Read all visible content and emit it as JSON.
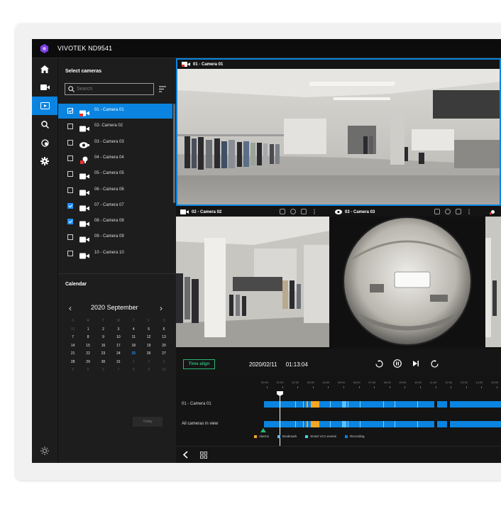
{
  "app": {
    "title": "VIVOTEK ND9541",
    "accent": "#0a84e0",
    "frame_bg": "#f1f1f1"
  },
  "nav_icons": [
    "home-icon",
    "camera-icon",
    "playback-icon",
    "search-icon",
    "exclude-icon",
    "gear-icon"
  ],
  "nav_active": "playback-icon",
  "sidebar": {
    "select_title": "Select cameras",
    "search_placeholder": "Search",
    "cameras": [
      {
        "label": "01 - Camera 01",
        "checked": true,
        "selected": true,
        "icon": "camera-alert-icon"
      },
      {
        "label": "02- Camera 02",
        "checked": false,
        "selected": false,
        "icon": "camera-icon"
      },
      {
        "label": "03 - Camera 03",
        "checked": false,
        "selected": false,
        "icon": "fisheye-icon"
      },
      {
        "label": "04 - Camera 04",
        "checked": false,
        "selected": false,
        "icon": "ptz-alert-icon"
      },
      {
        "label": "05 - Camera 05",
        "checked": false,
        "selected": false,
        "icon": "camera-icon"
      },
      {
        "label": "06 - Camera 06",
        "checked": false,
        "selected": false,
        "icon": "camera-icon"
      },
      {
        "label": "07 - Camera 07",
        "checked": true,
        "selected": false,
        "icon": "camera-icon"
      },
      {
        "label": "08 - Camera 08",
        "checked": true,
        "selected": false,
        "icon": "camera-icon"
      },
      {
        "label": "09 - Camera 09",
        "checked": false,
        "selected": false,
        "icon": "camera-icon"
      },
      {
        "label": "10 - Camera 10",
        "checked": false,
        "selected": false,
        "icon": "camera-icon"
      }
    ],
    "calendar_title": "Calendar",
    "calendar": {
      "month_label": "2020 September",
      "weekdays": [
        "S",
        "M",
        "T",
        "W",
        "T",
        "F",
        "S"
      ],
      "weeks": [
        [
          "31",
          "1",
          "2",
          "3",
          "4",
          "5",
          "6"
        ],
        [
          "7",
          "8",
          "9",
          "10",
          "11",
          "12",
          "13"
        ],
        [
          "14",
          "15",
          "16",
          "17",
          "18",
          "19",
          "20"
        ],
        [
          "21",
          "22",
          "23",
          "24",
          "25",
          "26",
          "27"
        ],
        [
          "28",
          "29",
          "30",
          "31",
          "1",
          "2",
          "3"
        ],
        [
          "4",
          "5",
          "6",
          "7",
          "8",
          "9",
          "10"
        ]
      ],
      "highlight": "25",
      "today_button": "Today"
    }
  },
  "views": {
    "cam1_title": "01 - Camera 01",
    "cam2_title": "02 - Camera 02",
    "cam3_title": "03 - Camera 03"
  },
  "playback": {
    "time_align_label": "Time align",
    "date": "2020/02/11",
    "time": "01:13:04",
    "hours": [
      "00:00",
      "01:00",
      "02:00",
      "03:00",
      "04:00",
      "05:00",
      "06:00",
      "07:00",
      "08:00",
      "09:00",
      "10:00",
      "11:00",
      "12:00",
      "13:00",
      "14:00",
      "15:00"
    ],
    "rows": [
      "01 - Camera 01",
      "All cameras in view"
    ],
    "legend": [
      {
        "label": "Alarms",
        "color": "#f5a623"
      },
      {
        "label": "Bookmark",
        "color": "#5bc0ff"
      },
      {
        "label": "Smart VCA events",
        "color": "#3ed6e8"
      },
      {
        "label": "Recording",
        "color": "#0a84e0"
      }
    ]
  }
}
